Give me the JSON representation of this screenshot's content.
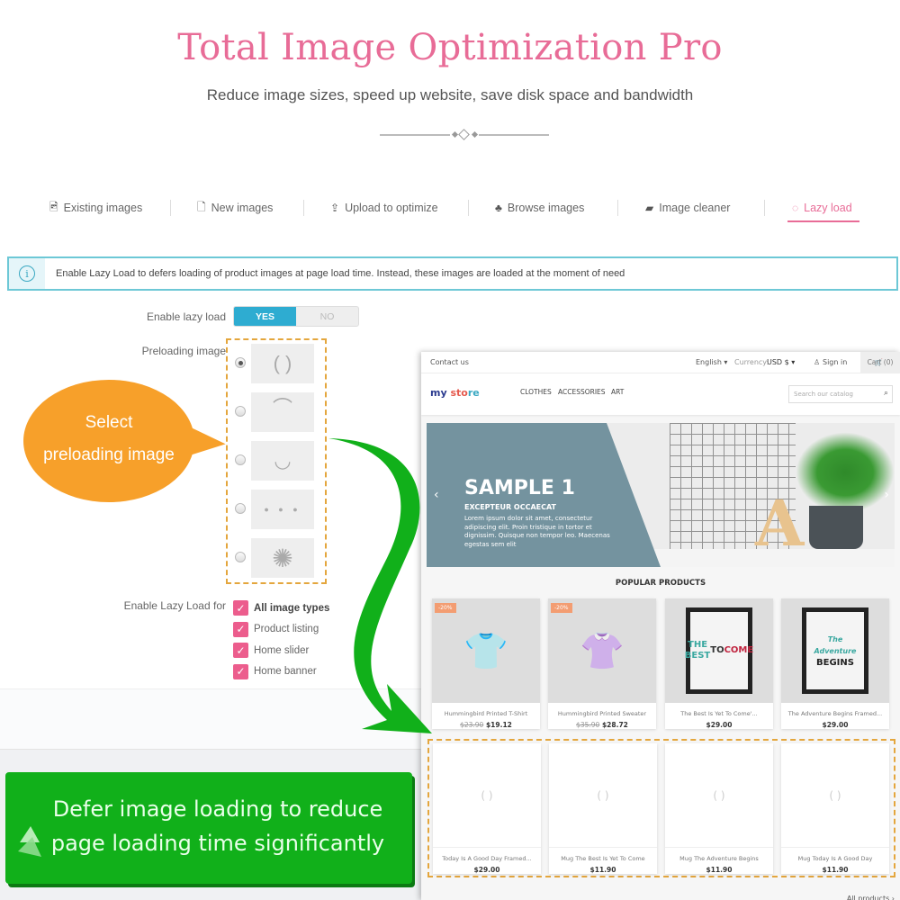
{
  "header": {
    "title": "Total Image Optimization Pro",
    "subtitle": "Reduce image sizes, speed up website, save disk space and bandwidth"
  },
  "tabs": [
    {
      "label": "Existing images",
      "icon": "image-icon",
      "glyph": "🖻"
    },
    {
      "label": "New images",
      "icon": "file-icon",
      "glyph": "🗋"
    },
    {
      "label": "Upload to optimize",
      "icon": "upload-icon",
      "glyph": "⇪"
    },
    {
      "label": "Browse images",
      "icon": "sitemap-icon",
      "glyph": "♣"
    },
    {
      "label": "Image cleaner",
      "icon": "eraser-icon",
      "glyph": "▰"
    },
    {
      "label": "Lazy load",
      "icon": "spinner-icon",
      "glyph": "◌",
      "active": true
    }
  ],
  "info": {
    "icon": "info-icon",
    "text": "Enable Lazy Load to defers loading of product images at page load time. Instead, these images are loaded at the moment of need"
  },
  "form": {
    "enable_label": "Enable lazy load",
    "yes": "YES",
    "no": "NO",
    "enabled": true,
    "preload_label": "Preloading image",
    "preload_options": [
      {
        "name": "brackets",
        "glyph": "(   )",
        "selected": true
      },
      {
        "name": "arc",
        "glyph": "⌒",
        "selected": false
      },
      {
        "name": "dotted-arc",
        "glyph": "◡",
        "selected": false
      },
      {
        "name": "three-dots",
        "glyph": "● ● ●",
        "selected": false
      },
      {
        "name": "sunburst",
        "glyph": "✺",
        "selected": false
      }
    ],
    "lazy_for_label": "Enable Lazy Load for",
    "lazy_for": [
      {
        "label": "All image types",
        "checked": true
      },
      {
        "label": "Product listing",
        "checked": true
      },
      {
        "label": "Home slider",
        "checked": true
      },
      {
        "label": "Home banner",
        "checked": true
      }
    ]
  },
  "callouts": {
    "bubble_line1": "Select",
    "bubble_line2": "preloading image",
    "banner_line1": "Defer image loading to reduce",
    "banner_line2": "page loading time significantly"
  },
  "store": {
    "contact": "Contact us",
    "language": "English ▾",
    "currency_label": "Currency:",
    "currency": "USD $ ▾",
    "sign_in": "Sign in",
    "cart": "Cart (0)",
    "logo": [
      "my",
      " sto",
      "re"
    ],
    "nav": [
      "CLOTHES",
      "ACCESSORIES",
      "ART"
    ],
    "search_placeholder": "Search our catalog",
    "slide": {
      "title": "SAMPLE 1",
      "subtitle": "EXCEPTEUR OCCAECAT",
      "body": "Lorem ipsum dolor sit amet, consectetur adipiscing elit. Proin tristique in tortor et dignissim. Quisque non tempor leo. Maecenas egestas sem elit"
    },
    "section_title": "POPULAR PRODUCTS",
    "products": [
      {
        "name": "Hummingbird Printed T-Shirt",
        "old_price": "$23.90",
        "price": "$19.12",
        "discount": "-20%"
      },
      {
        "name": "Hummingbird Printed Sweater",
        "old_price": "$35.90",
        "price": "$28.72",
        "discount": "-20%"
      },
      {
        "name": "The Best Is Yet To Come'...",
        "old_price": "",
        "price": "$29.00",
        "discount": ""
      },
      {
        "name": "The Adventure Begins Framed...",
        "old_price": "",
        "price": "$29.00",
        "discount": ""
      }
    ],
    "lazy_products": [
      {
        "name": "Today Is A Good Day Framed...",
        "price": "$29.00"
      },
      {
        "name": "Mug The Best Is Yet To Come",
        "price": "$11.90"
      },
      {
        "name": "Mug The Adventure Begins",
        "price": "$11.90"
      },
      {
        "name": "Mug Today Is A Good Day",
        "price": "$11.90"
      }
    ],
    "placeholder_glyph": "(   )",
    "all_products": "All products ›"
  },
  "colors": {
    "accent_pink": "#e86c97",
    "info_border": "#6dc8d6",
    "toggle_blue": "#2eacd1",
    "checkbox_pink": "#ec5d8d",
    "callout_orange": "#f7a02a",
    "banner_green": "#11b01a",
    "dashed_orange": "#e4a63d"
  }
}
